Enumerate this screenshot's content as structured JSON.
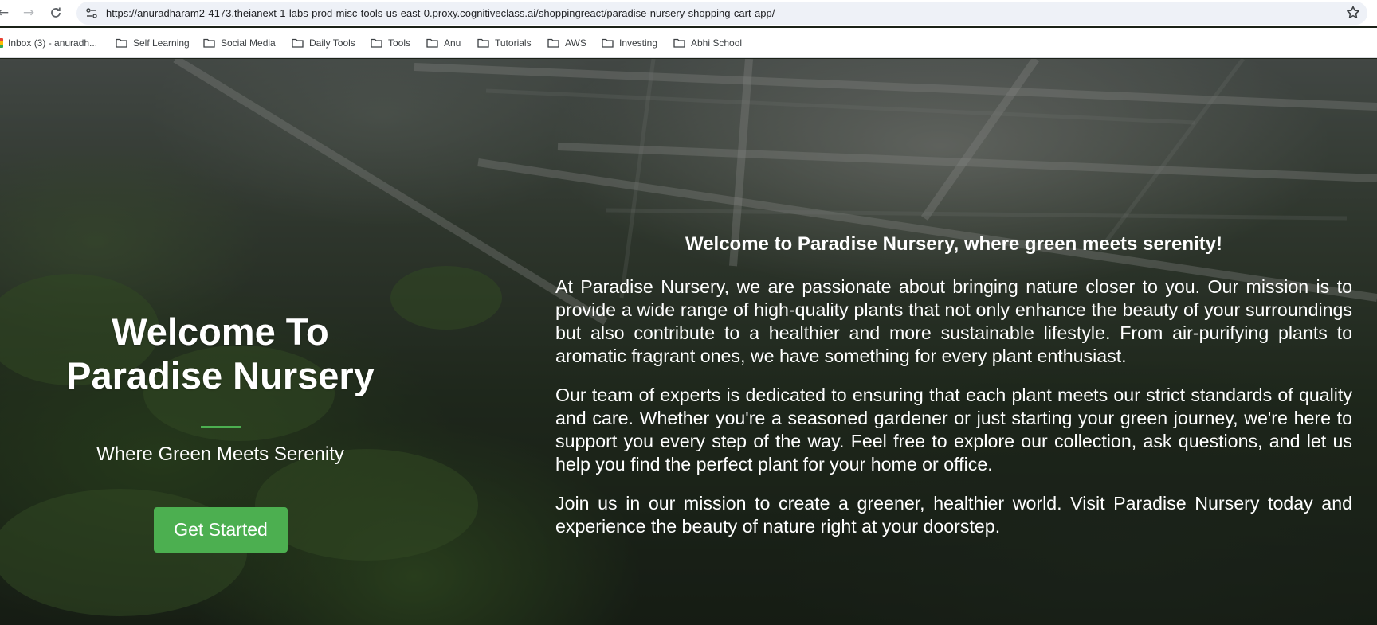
{
  "browser": {
    "url": "https://anuradharam2-4173.theianext-1-labs-prod-misc-tools-us-east-0.proxy.cognitiveclass.ai/shoppingreact/paradise-nursery-shopping-cart-app/",
    "nav_icons": [
      "back-arrow-icon",
      "forward-arrow-icon",
      "reload-icon"
    ],
    "bookmarks": [
      {
        "label": "Inbox (3) - anuradh...",
        "icon": "gmail-icon"
      },
      {
        "label": "Self Learning",
        "icon": "folder-icon"
      },
      {
        "label": "Social Media",
        "icon": "folder-icon"
      },
      {
        "label": "Daily Tools",
        "icon": "folder-icon"
      },
      {
        "label": "Tools",
        "icon": "folder-icon"
      },
      {
        "label": "Anu",
        "icon": "folder-icon"
      },
      {
        "label": "Tutorials",
        "icon": "folder-icon"
      },
      {
        "label": "AWS",
        "icon": "folder-icon"
      },
      {
        "label": "Investing",
        "icon": "folder-icon"
      },
      {
        "label": "Abhi School",
        "icon": "folder-icon"
      }
    ]
  },
  "hero": {
    "title_line1": "Welcome To",
    "title_line2": "Paradise Nursery",
    "tagline": "Where Green Meets Serenity",
    "cta_label": "Get Started",
    "accent_color": "#4caf50"
  },
  "about": {
    "heading": "Welcome to Paradise Nursery, where green meets serenity!",
    "paragraphs": [
      "At Paradise Nursery, we are passionate about bringing nature closer to you. Our mission is to provide a wide range of high-quality plants that not only enhance the beauty of your surroundings but also contribute to a healthier and more sustainable lifestyle. From air-purifying plants to aromatic fragrant ones, we have something for every plant enthusiast.",
      "Our team of experts is dedicated to ensuring that each plant meets our strict standards of quality and care. Whether you're a seasoned gardener or just starting your green journey, we're here to support you every step of the way. Feel free to explore our collection, ask questions, and let us help you find the perfect plant for your home or office.",
      "Join us in our mission to create a greener, healthier world. Visit Paradise Nursery today and experience the beauty of nature right at your doorstep."
    ]
  }
}
